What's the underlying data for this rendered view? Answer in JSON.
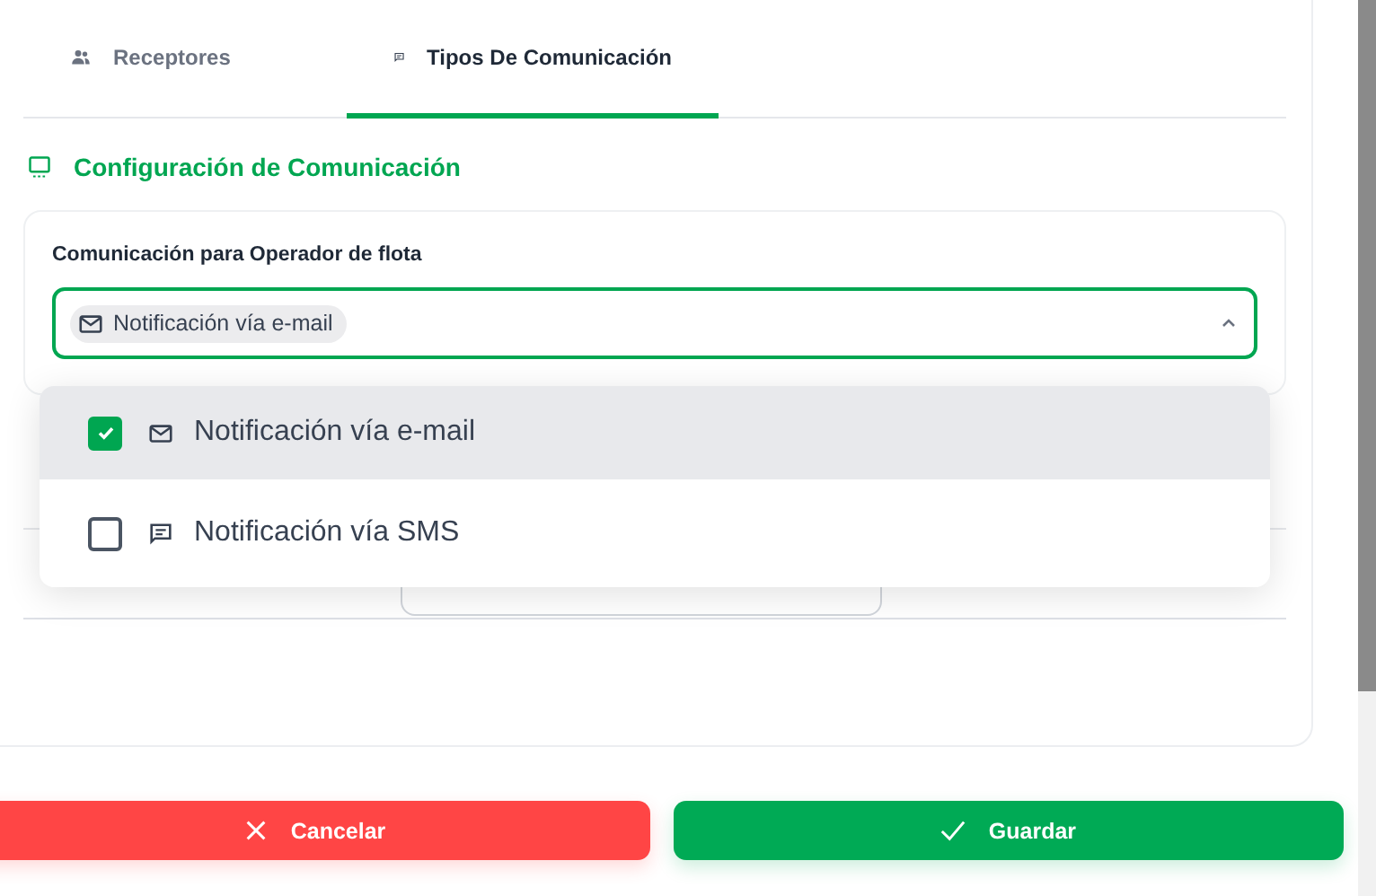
{
  "tabs": [
    {
      "label": "Receptores",
      "kind": "people",
      "selected": false
    },
    {
      "label": "Tipos De Comunicación",
      "kind": "chat",
      "selected": true
    }
  ],
  "section": {
    "title": "Configuración de Comunicación"
  },
  "field": {
    "label": "Comunicación para Operador de flota",
    "chips": [
      {
        "label": "Notificación vía e-mail",
        "kind": "mail"
      }
    ],
    "expanded": true
  },
  "options": [
    {
      "label": "Notificación vía e-mail",
      "kind": "mail",
      "checked": true
    },
    {
      "label": "Notificación vía SMS",
      "kind": "chat",
      "checked": false
    }
  ],
  "buttons": [
    {
      "label": "Cancelar",
      "kind": "cancel"
    },
    {
      "label": "Guardar",
      "kind": "save"
    }
  ]
}
